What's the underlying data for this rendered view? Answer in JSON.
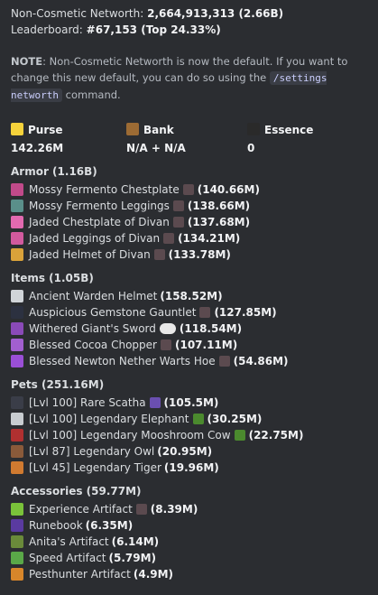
{
  "header": {
    "networth_label": "Non-Cosmetic Networth:",
    "networth_value": "2,664,913,313 (2.66B)",
    "leaderboard_label": "Leaderboard:",
    "leaderboard_value": "#67,153 (Top 24.33%)"
  },
  "note": {
    "prefix": "NOTE",
    "text": ": Non-Cosmetic Networth is now the default. If you want to change this new default, you can do so using the ",
    "command": "/settings networth",
    "suffix": " command."
  },
  "stats": [
    {
      "label": "Purse",
      "value": "142.26M",
      "icon": "gold-ingot-icon",
      "color": "#f5d23b"
    },
    {
      "label": "Bank",
      "value": "N/A + N/A",
      "icon": "chest-icon",
      "color": "#9c6b34"
    },
    {
      "label": "Essence",
      "value": "0",
      "icon": "wither-essence-icon",
      "color": "#2a2a2a"
    }
  ],
  "sections": [
    {
      "title": "Armor (1.16B)",
      "items": [
        {
          "name": "Mossy Fermento Chestplate",
          "value": "(140.66M)",
          "icon": "chestplate-icon",
          "color": "#c14a8a",
          "extra": "recomb-icon"
        },
        {
          "name": "Mossy Fermento Leggings",
          "value": "(138.66M)",
          "icon": "leggings-icon",
          "color": "#5a8f8a",
          "extra": "recomb-icon"
        },
        {
          "name": "Jaded Chestplate of Divan",
          "value": "(137.68M)",
          "icon": "chestplate-icon",
          "color": "#e26ab0",
          "extra": "recomb-icon"
        },
        {
          "name": "Jaded Leggings of Divan",
          "value": "(134.21M)",
          "icon": "leggings-icon",
          "color": "#d25a9e",
          "extra": "recomb-icon"
        },
        {
          "name": "Jaded Helmet of Divan",
          "value": "(133.78M)",
          "icon": "helmet-icon",
          "color": "#d9a23a",
          "extra": "recomb-icon"
        }
      ]
    },
    {
      "title": "Items (1.05B)",
      "items": [
        {
          "name": "Ancient Warden Helmet",
          "value": "(158.52M)",
          "icon": "skull-icon",
          "color": "#d0d4d8",
          "extra": ""
        },
        {
          "name": "Auspicious Gemstone Gauntlet",
          "value": "(127.85M)",
          "icon": "gauntlet-icon",
          "color": "#2c3140",
          "extra": "recomb-icon"
        },
        {
          "name": "Withered Giant's Sword",
          "value": "(118.54M)",
          "icon": "sword-icon",
          "color": "#8a4ab8",
          "extra": "gemstones-icon"
        },
        {
          "name": "Blessed Cocoa Chopper",
          "value": "(107.11M)",
          "icon": "axe-icon",
          "color": "#a25fd0",
          "extra": "recomb-icon"
        },
        {
          "name": "Blessed Newton Nether Warts Hoe",
          "value": "(54.86M)",
          "icon": "hoe-icon",
          "color": "#9a4fd6",
          "extra": "recomb-icon"
        }
      ]
    },
    {
      "title": "Pets (251.16M)",
      "items": [
        {
          "name": "[Lvl 100] Rare Scatha",
          "value": "(105.5M)",
          "icon": "scatha-icon",
          "color": "#3a3d48",
          "extra": "pickaxe-icon"
        },
        {
          "name": "[Lvl 100] Legendary Elephant",
          "value": "(30.25M)",
          "icon": "elephant-icon",
          "color": "#c8ccd0",
          "extra": "leaf-icon"
        },
        {
          "name": "[Lvl 100] Legendary Mooshroom Cow",
          "value": "(22.75M)",
          "icon": "mooshroom-icon",
          "color": "#b03030",
          "extra": "leaf-icon"
        },
        {
          "name": "[Lvl 87] Legendary Owl",
          "value": "(20.95M)",
          "icon": "owl-icon",
          "color": "#8a5a3a",
          "extra": ""
        },
        {
          "name": "[Lvl 45] Legendary Tiger",
          "value": "(19.96M)",
          "icon": "tiger-icon",
          "color": "#d07a30",
          "extra": ""
        }
      ]
    },
    {
      "title": "Accessories (59.77M)",
      "items": [
        {
          "name": "Experience Artifact",
          "value": "(8.39M)",
          "icon": "experience-icon",
          "color": "#7ac23a",
          "extra": "recomb-icon"
        },
        {
          "name": "Runebook",
          "value": "(6.35M)",
          "icon": "runebook-icon",
          "color": "#5a3aa0",
          "extra": ""
        },
        {
          "name": "Anita's Artifact",
          "value": "(6.14M)",
          "icon": "anita-icon",
          "color": "#6a8a3a",
          "extra": ""
        },
        {
          "name": "Speed Artifact",
          "value": "(5.79M)",
          "icon": "speed-icon",
          "color": "#5aa848",
          "extra": ""
        },
        {
          "name": "Pesthunter Artifact",
          "value": "(4.9M)",
          "icon": "pesthunter-icon",
          "color": "#d8862a",
          "extra": ""
        }
      ]
    }
  ],
  "colors": {
    "background": "#2b2d31",
    "text": "#dbdee1",
    "recomb": "#5b4a4f",
    "leaf": "#4b8a2e"
  }
}
